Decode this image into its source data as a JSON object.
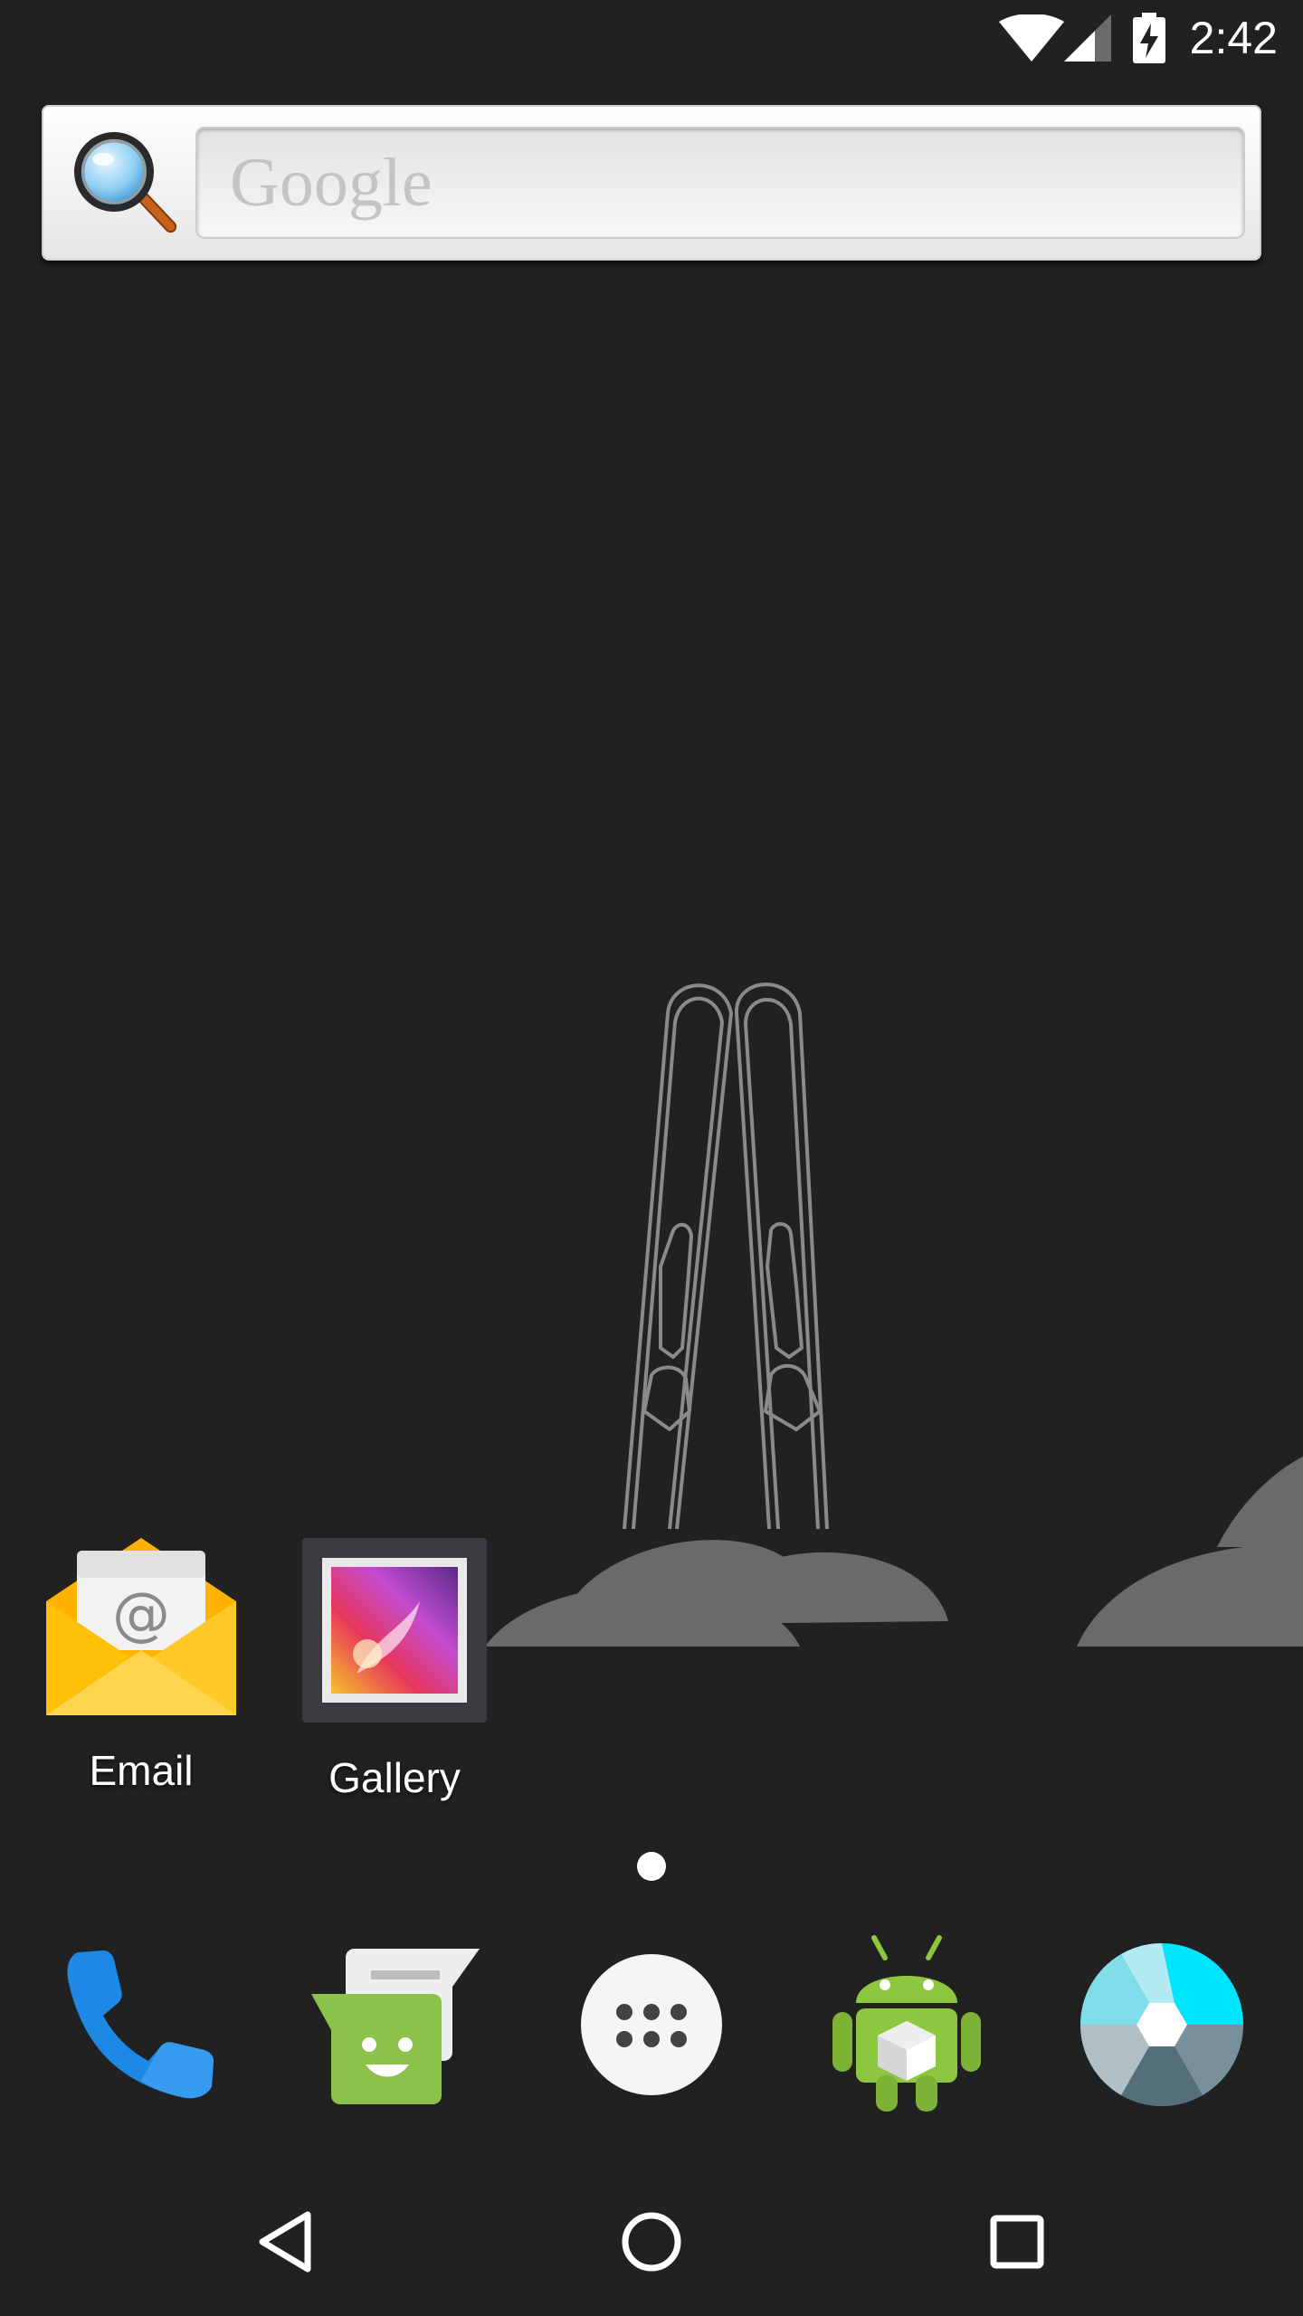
{
  "status_bar": {
    "time": "2:42",
    "icons": [
      "wifi-icon",
      "cell-signal-icon",
      "battery-charging-icon"
    ]
  },
  "search_widget": {
    "placeholder": "Google",
    "icon": "magnifier-icon"
  },
  "home_apps": [
    {
      "label": "Email",
      "icon": "email-icon"
    },
    {
      "label": "Gallery",
      "icon": "gallery-icon"
    }
  ],
  "page_indicator": {
    "pages": 1,
    "current": 1
  },
  "dock": [
    {
      "name": "Phone",
      "icon": "phone-icon"
    },
    {
      "name": "Messaging",
      "icon": "messaging-icon"
    },
    {
      "name": "All apps",
      "icon": "app-drawer-icon"
    },
    {
      "name": "Android app",
      "icon": "android-icon"
    },
    {
      "name": "Camera",
      "icon": "camera-aperture-icon"
    }
  ],
  "nav_bar": {
    "buttons": [
      "back-icon",
      "home-icon",
      "recents-icon"
    ]
  },
  "colors": {
    "background": "#212121",
    "wallpaper_line": "#8a8a8a",
    "hill": "#6a6a6a",
    "phone_blue": "#1e88e5",
    "message_green": "#8bc34a",
    "android_green": "#8dc63f",
    "email_yellow": "#ffc107"
  }
}
